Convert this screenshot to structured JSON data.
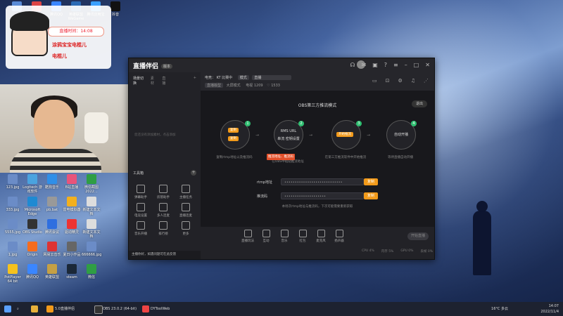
{
  "colors": {
    "accent": "#f29a1a",
    "step_done": "#2fbf71",
    "app_bg": "#1e1e22",
    "warn": "#e4502a"
  },
  "overlay": {
    "time_label": "直播时间：14:08",
    "line1": "涂鸦宝宝电棍儿",
    "line2": "电棍儿"
  },
  "desktop_icons_top": [
    {
      "label": "",
      "color": "#5a8bd6"
    },
    {
      "label": "Wegame",
      "color": "#d44"
    },
    {
      "label": "腾讯QQ",
      "color": "#3a86ff"
    },
    {
      "label": "英雄联盟WeGame",
      "color": "#2c6bb5"
    },
    {
      "label": "腾讯应用宝",
      "color": "#3aa0ff"
    },
    {
      "label": "抖音",
      "color": "#111"
    }
  ],
  "desktop_icons_left": [
    {
      "label": "123.jpg",
      "color": "#6b8cc7"
    },
    {
      "label": "Logitech 游戏软件",
      "color": "#4aa3df"
    },
    {
      "label": "酷狗音乐",
      "color": "#2f8fe8"
    },
    {
      "label": "B站直播",
      "color": "#e8547a"
    },
    {
      "label": "微信截图 2022...",
      "color": "#2f9e44"
    },
    {
      "label": "333.jpg",
      "color": "#6b8cc7"
    },
    {
      "label": "Microsoft Edge",
      "color": "#1f8ad2"
    },
    {
      "label": "pb.bat",
      "color": "#999"
    },
    {
      "label": "雷电模拟器",
      "color": "#f2b01e"
    },
    {
      "label": "新建文本文档",
      "color": "#ddd"
    },
    {
      "label": "5555.jpg",
      "color": "#6b8cc7"
    },
    {
      "label": "OBS Studio",
      "color": "#333"
    },
    {
      "label": "腾讯会议",
      "color": "#2f6fe0"
    },
    {
      "label": "驱动精灵",
      "color": "#e33"
    },
    {
      "label": "新建文本文档",
      "color": "#ddd"
    },
    {
      "label": "1.jpg",
      "color": "#6b8cc7"
    },
    {
      "label": "Origin",
      "color": "#f56c1e"
    },
    {
      "label": "网易云音乐",
      "color": "#d33"
    },
    {
      "label": "夏日小作品",
      "color": "#666"
    },
    {
      "label": "666666.jpg",
      "color": "#6b8cc7"
    },
    {
      "label": "PotPlayer 64 bit",
      "color": "#f5c21e"
    },
    {
      "label": "腾讯QQ",
      "color": "#3a86ff"
    },
    {
      "label": "英雄联盟",
      "color": "#c5a044"
    },
    {
      "label": "steam",
      "color": "#1b2838"
    },
    {
      "label": "微信",
      "color": "#2f9e44"
    }
  ],
  "app": {
    "name": "直播伴侣",
    "version_badge": "版本",
    "side_tabs": [
      "场景切换",
      "素材",
      "直播",
      "+"
    ],
    "side_empty_text": "您还没有添加素材，点击添加",
    "tools_heading": "工具箱",
    "tools_plus": "+",
    "tools": [
      {
        "label": "弹幕助手"
      },
      {
        "label": "房管助手"
      },
      {
        "label": "主播任务"
      },
      {
        "label": "电竞设置"
      },
      {
        "label": "多人连麦"
      },
      {
        "label": "直播连麦"
      },
      {
        "label": "音乐开播"
      },
      {
        "label": "排行榜"
      },
      {
        "label": "更多"
      }
    ],
    "notice": "主播你好，如遇问题可在此反馈",
    "top": {
      "cat_label": "电竞",
      "room_name": "KT 比赛中",
      "mode_pill": "模式",
      "stream_pill": "直播",
      "row2_pill": "直播版型",
      "row2_type": "大屏模式",
      "row2_viewers_label": "电视",
      "row2_viewers": "1209",
      "row2_likes": "1533"
    },
    "stage": {
      "mode_title": "OBS第三方推流模式",
      "exit": "退出",
      "steps": [
        {
          "num": "1",
          "label": "复制",
          "desc": "复制rtmp地址以及推流码"
        },
        {
          "num": "2",
          "label": "RMS URL",
          "sub": "串流 密钥设置",
          "desc": "在OBS中粘贴推流地址"
        },
        {
          "num": "3",
          "label": "开始推流",
          "desc": "在第三方推流软件中开始推流"
        },
        {
          "num": "4",
          "label": "自动开播",
          "desc": "等待直播自动开播"
        }
      ],
      "step1_chip1": "复制",
      "step1_chip2": "复制",
      "step3_chip": "开始推流",
      "tip_red": "推流地址、推流码",
      "rtmp_label": "rtmp地址",
      "rtmp_value": "••••••••••••••••••••••••••••",
      "key_label": "推流码",
      "key_value": "••••••••••••••••••••",
      "copy_label": "复制",
      "hint": "本场次rtmp地址与推流码，下次可能需要重新获取"
    },
    "bottom": {
      "tools": [
        "直播玩法",
        "互动",
        "音乐",
        "红包",
        "麦克风",
        "扬声器"
      ],
      "start_label": "开始直播",
      "stats": [
        "CPU 4%",
        "内存 5%",
        "GPU 0%",
        "丢帧 0%"
      ]
    }
  },
  "taskbar": {
    "items": [
      "5.0直播伴侣",
      "OBS 23.0.2 (64-bit)",
      "DYToolWeb"
    ],
    "weather": "16°C 多云",
    "time": "14:07",
    "date": "2022/11/4"
  }
}
